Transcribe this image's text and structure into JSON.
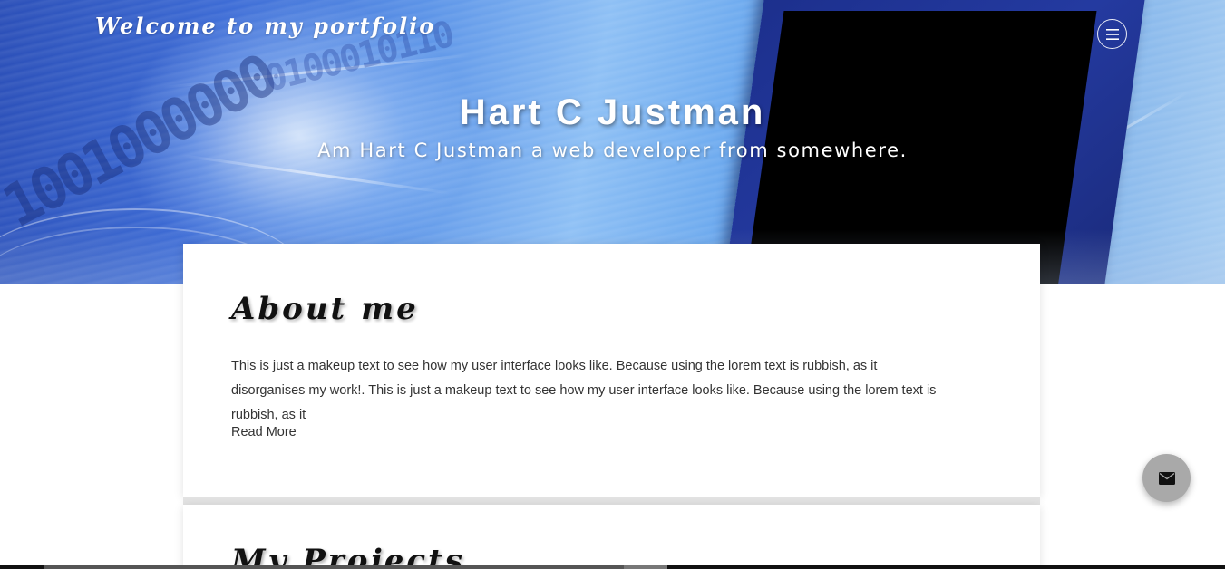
{
  "header": {
    "brand": "Welcome to my portfolio",
    "menu_icon": "hamburger-menu-icon"
  },
  "hero": {
    "title": "Hart C Justman",
    "subtitle": "Am Hart C Justman a web developer from somewhere."
  },
  "about": {
    "title": "About me",
    "text": "This is just a makeup text to see how my user interface looks like. Because using the lorem text is rubbish, as it disorganises my work!. This is just a makeup text to see how my user interface looks like. Because using the lorem text is rubbish, as it",
    "read_more": "Read More"
  },
  "projects": {
    "title": "My Projects"
  },
  "fab": {
    "icon": "envelope-icon"
  },
  "colors": {
    "hero_blue": "#3d6cd6",
    "card_bg": "#ffffff",
    "divider": "#e2e2e2",
    "fab_bg": "#a9a9a9"
  }
}
